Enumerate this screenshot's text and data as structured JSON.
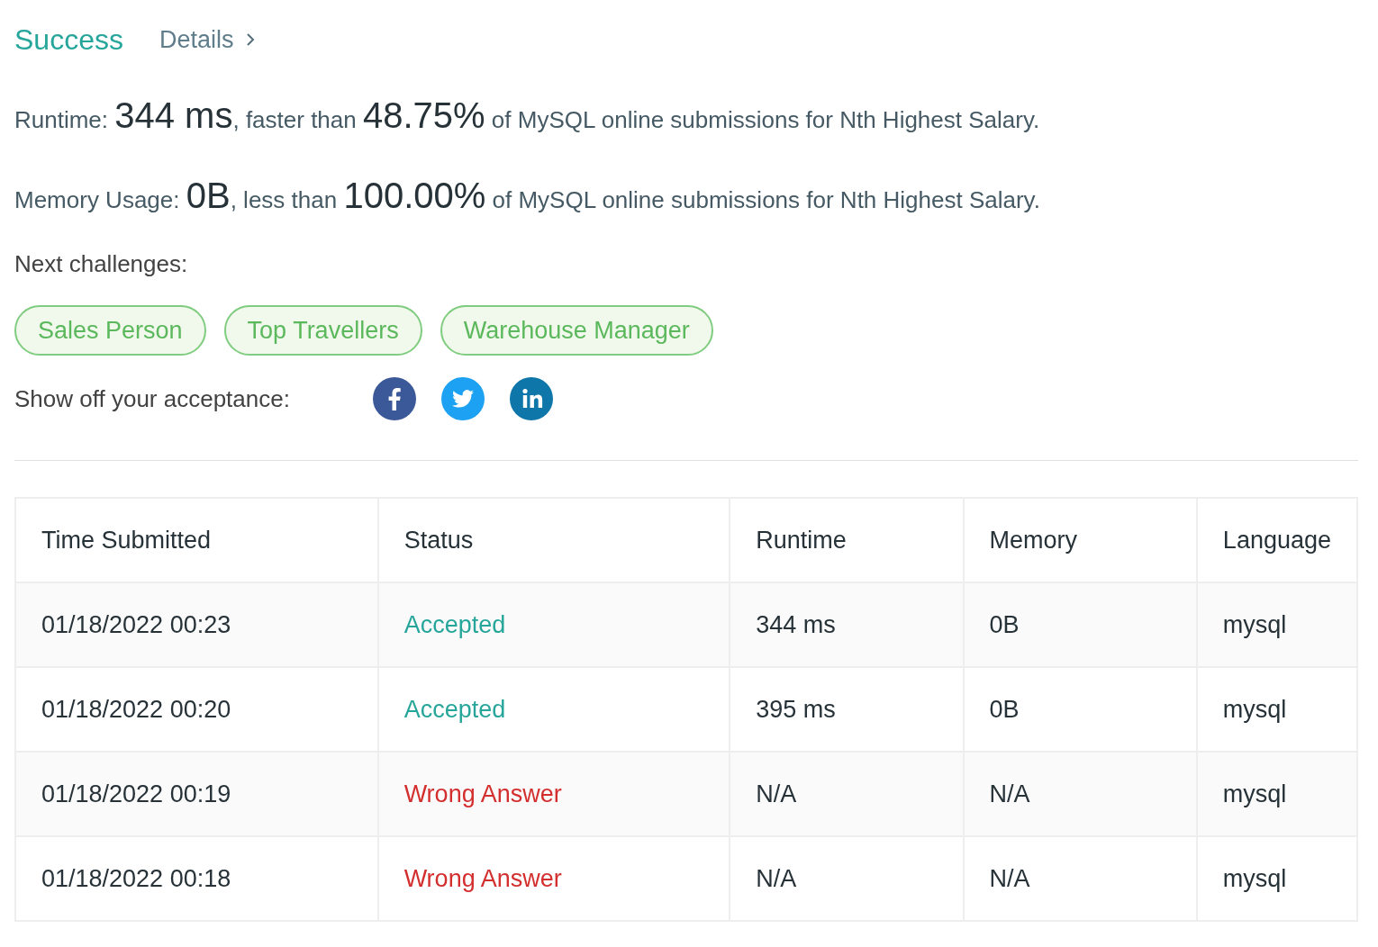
{
  "result": {
    "status": "Success",
    "details_link": "Details"
  },
  "runtime": {
    "label": "Runtime:",
    "value": "344 ms",
    "comparison": ", faster than",
    "percentile": "48.75%",
    "suffix": "of MySQL online submissions for Nth Highest Salary."
  },
  "memory": {
    "label": "Memory Usage:",
    "value": "0B",
    "comparison": ", less than",
    "percentile": "100.00%",
    "suffix": "of MySQL online submissions for Nth Highest Salary."
  },
  "next_challenges": {
    "label": "Next challenges:",
    "items": [
      "Sales Person",
      "Top Travellers",
      "Warehouse Manager"
    ]
  },
  "share": {
    "label": "Show off your acceptance:",
    "networks": [
      {
        "kind": "facebook",
        "color": "#3b5998"
      },
      {
        "kind": "twitter",
        "color": "#1da1f2"
      },
      {
        "kind": "linkedin",
        "color": "#0e76a8"
      }
    ]
  },
  "table": {
    "columns": [
      "Time Submitted",
      "Status",
      "Runtime",
      "Memory",
      "Language"
    ],
    "rows": [
      {
        "time": "01/18/2022 00:23",
        "status": "Accepted",
        "kind": "accepted",
        "runtime": "344 ms",
        "memory": "0B",
        "language": "mysql"
      },
      {
        "time": "01/18/2022 00:20",
        "status": "Accepted",
        "kind": "accepted",
        "runtime": "395 ms",
        "memory": "0B",
        "language": "mysql"
      },
      {
        "time": "01/18/2022 00:19",
        "status": "Wrong Answer",
        "kind": "wrong",
        "runtime": "N/A",
        "memory": "N/A",
        "language": "mysql"
      },
      {
        "time": "01/18/2022 00:18",
        "status": "Wrong Answer",
        "kind": "wrong",
        "runtime": "N/A",
        "memory": "N/A",
        "language": "mysql"
      }
    ]
  }
}
